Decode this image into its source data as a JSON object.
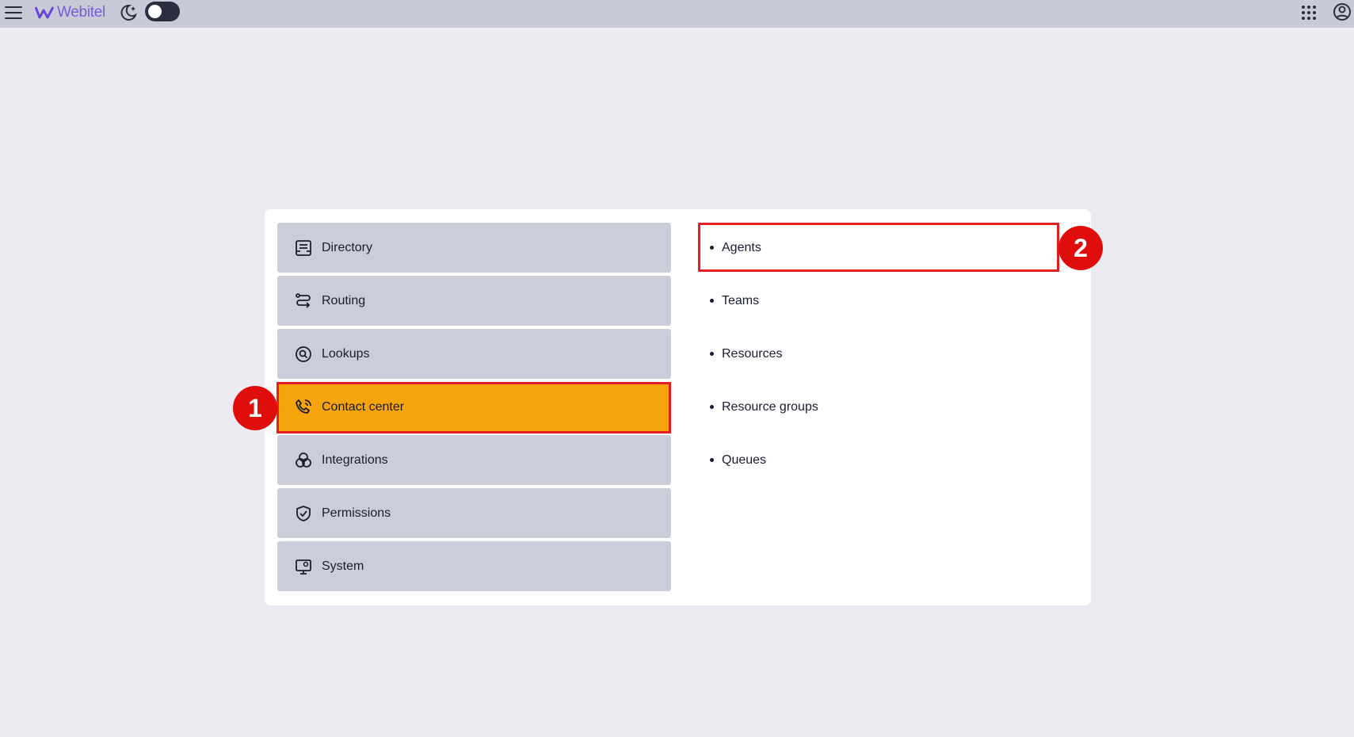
{
  "topbar": {
    "menu_icon": "hamburger-menu-icon",
    "logo_text": "Webitel",
    "theme_icon": "moon-icon",
    "apps_icon": "apps-grid-icon",
    "account_icon": "account-icon",
    "dark_mode_enabled": false
  },
  "nav": {
    "items": [
      {
        "label": "Directory",
        "icon": "directory-icon"
      },
      {
        "label": "Routing",
        "icon": "routing-icon"
      },
      {
        "label": "Lookups",
        "icon": "lookups-icon"
      },
      {
        "label": "Contact center",
        "icon": "contact-center-icon",
        "active": true
      },
      {
        "label": "Integrations",
        "icon": "integrations-icon"
      },
      {
        "label": "Permissions",
        "icon": "permissions-icon"
      },
      {
        "label": "System",
        "icon": "system-icon"
      }
    ]
  },
  "submenu": {
    "items": [
      {
        "label": "Agents"
      },
      {
        "label": "Teams"
      },
      {
        "label": "Resources"
      },
      {
        "label": "Resource groups"
      },
      {
        "label": "Queues"
      }
    ]
  },
  "annotations": {
    "marker_1": "1",
    "marker_2": "2"
  },
  "colors": {
    "active_item": "#f5a40c",
    "highlight_border": "#e41f1f",
    "marker_fill": "#e00d0d"
  }
}
